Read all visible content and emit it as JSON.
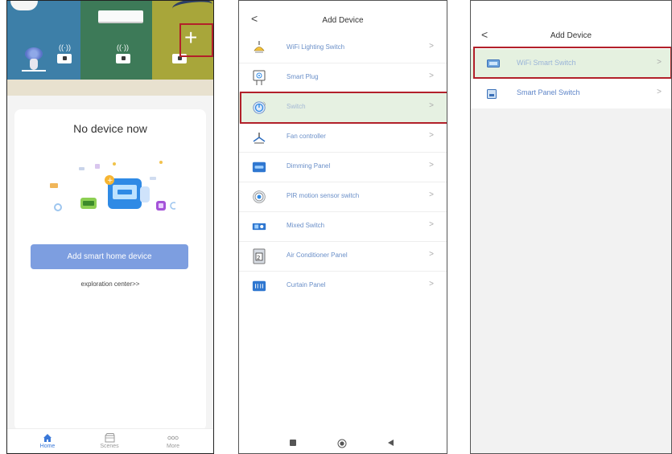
{
  "home": {
    "empty_title": "No device now",
    "add_button": "Add smart home device",
    "exploration_link": "exploration center>>",
    "plus_glyph": "+",
    "tabs": [
      {
        "label": "Home",
        "icon": "home-icon",
        "active": true
      },
      {
        "label": "Scenes",
        "icon": "scenes-icon",
        "active": false
      },
      {
        "label": "More",
        "icon": "more-icon",
        "active": false
      }
    ]
  },
  "device_list": {
    "title": "Add Device",
    "items": [
      {
        "label": "WiFi Lighting Switch",
        "icon": "lighting-switch-icon"
      },
      {
        "label": "Smart Plug",
        "icon": "smart-plug-icon"
      },
      {
        "label": "Switch",
        "icon": "switch-icon",
        "selected": true
      },
      {
        "label": "Fan controller",
        "icon": "fan-icon"
      },
      {
        "label": "Dimming Panel",
        "icon": "dimming-panel-icon"
      },
      {
        "label": "PIR motion sensor switch",
        "icon": "pir-sensor-icon"
      },
      {
        "label": "Mixed Switch",
        "icon": "mixed-switch-icon"
      },
      {
        "label": "Air Conditioner Panel",
        "icon": "ac-panel-icon"
      },
      {
        "label": "Curtain Panel",
        "icon": "curtain-panel-icon"
      }
    ]
  },
  "switch_list": {
    "title": "Add Device",
    "items": [
      {
        "label": "WiFi Smart Switch",
        "icon": "wifi-smart-switch-icon",
        "selected": true
      },
      {
        "label": "Smart Panel Switch",
        "icon": "smart-panel-switch-icon"
      }
    ]
  },
  "glyphs": {
    "chevron": ">",
    "back": "<"
  },
  "colors": {
    "accent": "#3a78d8",
    "highlight": "#b2202a",
    "button": "#7d9ee0",
    "selected_row": "#e6f1e2"
  }
}
